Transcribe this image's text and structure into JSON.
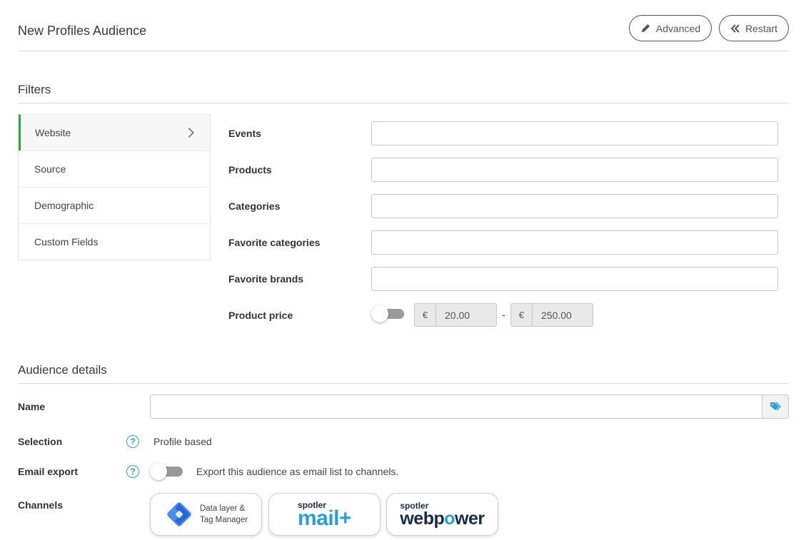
{
  "header": {
    "title": "New Profiles Audience",
    "advanced_label": "Advanced",
    "restart_label": "Restart"
  },
  "filters": {
    "title": "Filters",
    "sidebar": [
      {
        "label": "Website",
        "active": true
      },
      {
        "label": "Source"
      },
      {
        "label": "Demographic"
      },
      {
        "label": "Custom Fields"
      }
    ],
    "fields": {
      "events": "Events",
      "products": "Products",
      "categories": "Categories",
      "favorite_categories": "Favorite categories",
      "favorite_brands": "Favorite brands",
      "product_price": "Product price"
    },
    "price": {
      "currency": "€",
      "min": "20.00",
      "max": "250.00",
      "separator": "-"
    }
  },
  "details": {
    "title": "Audience details",
    "name_label": "Name",
    "selection_label": "Selection",
    "selection_value": "Profile based",
    "email_export_label": "Email export",
    "email_export_text": "Export this audience as email list to channels.",
    "channels_label": "Channels",
    "help_glyph": "?"
  },
  "channels": {
    "gtm_line1": "Data layer &",
    "gtm_line2": "Tag Manager",
    "mail_brand": "spotler",
    "mail_word": "mail+",
    "wp_brand": "spotler",
    "wp_word_a": "webp",
    "wp_word_o": "o",
    "wp_word_b": "wer"
  },
  "colors": {
    "accent_green": "#2eaa3f",
    "accent_blue": "#2a9fd6",
    "navy": "#1a2a4a"
  }
}
